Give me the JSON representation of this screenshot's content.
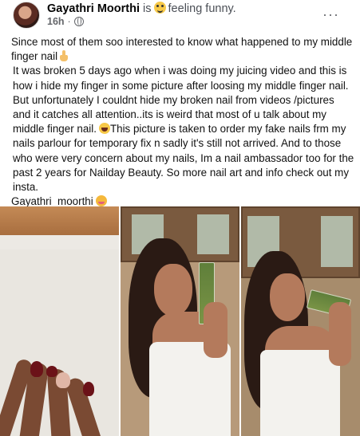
{
  "post": {
    "author": "Gayathri Moorthi",
    "is_text": "is",
    "feeling_text": "feeling funny.",
    "time": "16h",
    "more_label": "···",
    "paragraphs": [
      "Since most of them soo interested to know what happened to my middle finger nail",
      "It was broken 5 days ago when i was doing my juicing video and this is  how i hide my finger in some picture after loosing my middle finger nail. But unfortunately I couldnt hide my broken nail from videos /pictures and it catches all attention..its is weird that most of u talk about my middle finger nail.",
      "This picture is taken to order  my fake nails frm my nails parlour for temporary fix n sadly it's still not arrived. And to those who were very concern about my nails,  Im a nail ambassador too for the past 2 years for Nailday Beauty. So more nail art and info check out my insta.",
      "Gayathri_moorthi"
    ]
  },
  "photos": [
    {
      "name": "photo-hand-nails"
    },
    {
      "name": "photo-woman-drinking-juice-1"
    },
    {
      "name": "photo-woman-drinking-juice-2"
    }
  ],
  "icons": {
    "feeling": "laughing-emoji-icon",
    "audience": "globe-icon",
    "middle_finger": "middle-finger-emoji-icon",
    "laugh": "grinning-emoji-icon",
    "hug": "hugging-emoji-icon"
  },
  "colors": {
    "text": "#050505",
    "muted": "#65676b",
    "background": "#ffffff"
  }
}
